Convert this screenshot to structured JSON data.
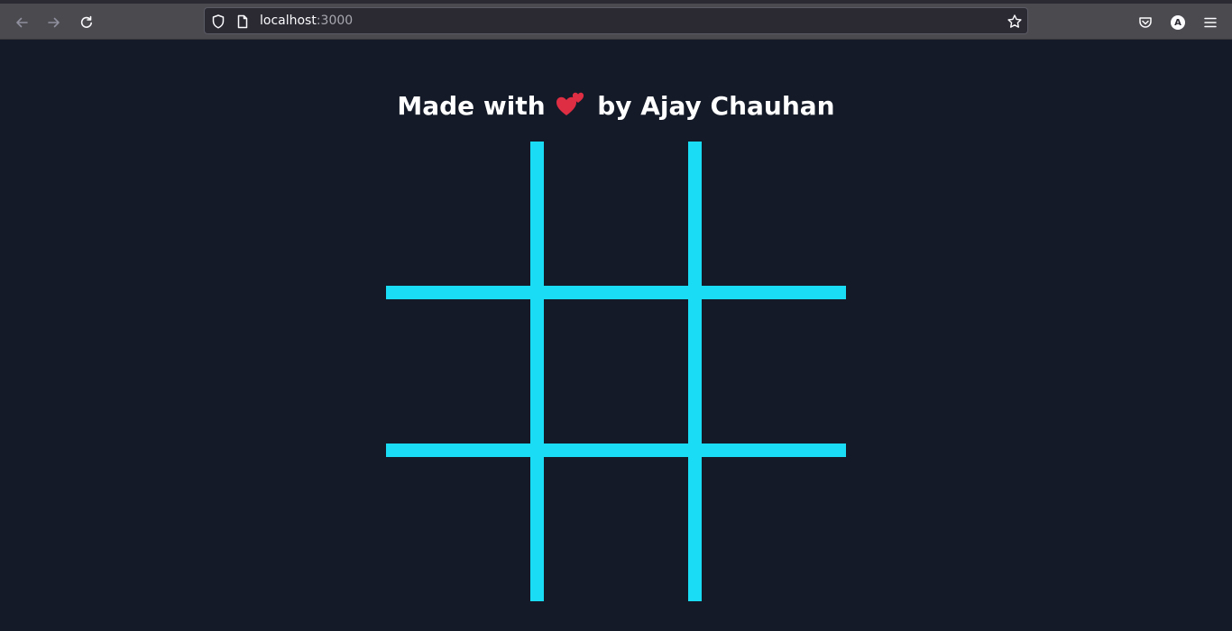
{
  "browser": {
    "url_host": "localhost",
    "url_port": ":3000",
    "avatar_letter": "A"
  },
  "page": {
    "title_before": "Made with",
    "heart_icon": "two-hearts-icon",
    "title_after": "by Ajay Chauhan"
  },
  "board": {
    "grid_color": "#1adcf4",
    "background_color": "#141a27",
    "cells": [
      "",
      "",
      "",
      "",
      "",
      "",
      "",
      "",
      ""
    ]
  }
}
